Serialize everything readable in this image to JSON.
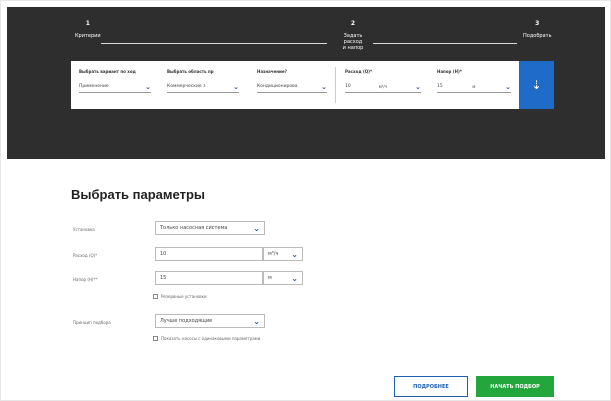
{
  "steps": [
    {
      "num": "1",
      "label": "Критерии"
    },
    {
      "num": "2",
      "label": "Задать расход\nи напор"
    },
    {
      "num": "3",
      "label": "Подобрать"
    }
  ],
  "filters": {
    "items": [
      {
        "label": "Выбрать вариант по ход",
        "value": "Применение"
      },
      {
        "label": "Выбрать область пр",
        "value": "Коммерческие з"
      },
      {
        "label": "Назначение?",
        "value": "Кондиционирова"
      },
      {
        "label": "Расход (Q)*",
        "value": "10",
        "unit": "м³/ч"
      },
      {
        "label": "Напор (H)*",
        "value": "15",
        "unit": "м"
      }
    ],
    "action_icon": "chevron-down-icon"
  },
  "form": {
    "title": "Выбрать параметры",
    "rows": [
      {
        "label": "Установка",
        "value": "Только насосная система"
      },
      {
        "label": "Расход (Q)*",
        "value": "10",
        "unit": "м³/ч"
      },
      {
        "label": "Напор (H)**",
        "value": "15",
        "unit": "м"
      },
      {
        "label": "Принцип подбора",
        "value": "Лучше подходящие"
      }
    ],
    "check_standby": "Резервные установки",
    "check_similar": "Показать насосы с одинаковыми параметрами",
    "btn_details": "ПОДРОБНЕЕ",
    "btn_start": "НАЧАТЬ ПОДБОР"
  },
  "colors": {
    "accent": "#1e6cc8",
    "primary_action": "#23a63c",
    "header_bg": "#2e2e2e"
  }
}
